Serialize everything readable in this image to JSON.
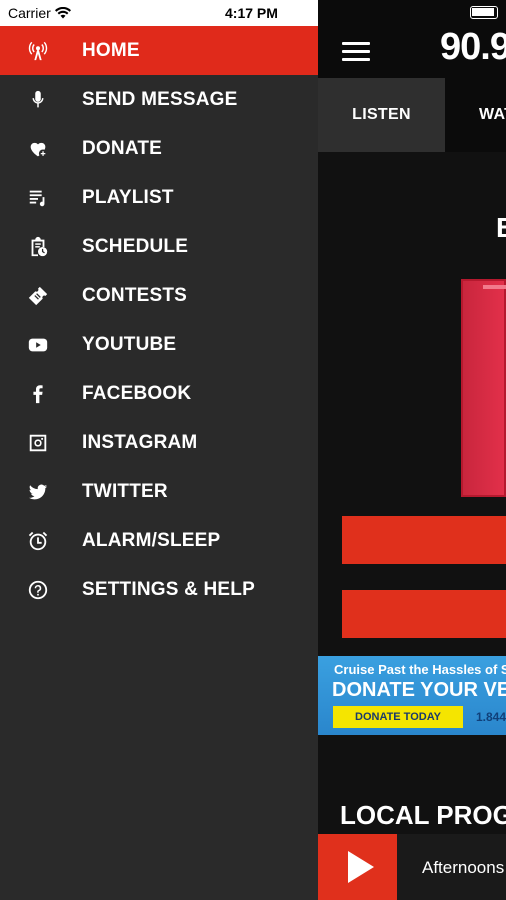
{
  "status_bar": {
    "carrier": "Carrier",
    "time": "4:17 PM"
  },
  "menu": {
    "items": [
      {
        "label": "HOME",
        "icon": "radio-tower-icon",
        "active": true
      },
      {
        "label": "SEND MESSAGE",
        "icon": "microphone-icon"
      },
      {
        "label": "DONATE",
        "icon": "heart-plus-icon"
      },
      {
        "label": "PLAYLIST",
        "icon": "playlist-icon"
      },
      {
        "label": "SCHEDULE",
        "icon": "clipboard-clock-icon"
      },
      {
        "label": "CONTESTS",
        "icon": "ticket-icon"
      },
      {
        "label": "YOUTUBE",
        "icon": "youtube-icon"
      },
      {
        "label": "FACEBOOK",
        "icon": "facebook-icon"
      },
      {
        "label": "INSTAGRAM",
        "icon": "instagram-icon"
      },
      {
        "label": "TWITTER",
        "icon": "twitter-icon"
      },
      {
        "label": "ALARM/SLEEP",
        "icon": "alarm-clock-icon"
      },
      {
        "label": "SETTINGS & HELP",
        "icon": "help-icon"
      }
    ]
  },
  "header": {
    "logo": "90.9"
  },
  "tabs": {
    "listen": "LISTEN",
    "watch": "WAT"
  },
  "content": {
    "heading_partial": "B",
    "ad": {
      "line1": "Cruise Past the Hassles of S",
      "line2": "DONATE YOUR VE",
      "cta": "DONATE TODAY",
      "phone": "1.844"
    },
    "local_programs": "LOCAL PROGRAMS",
    "now_playing": "Afternoons"
  },
  "colors": {
    "accent": "#e02a1b",
    "drawer_bg": "#2a2a2a",
    "ad_blue": "#3aa0e0",
    "ad_yellow": "#f5e500"
  }
}
